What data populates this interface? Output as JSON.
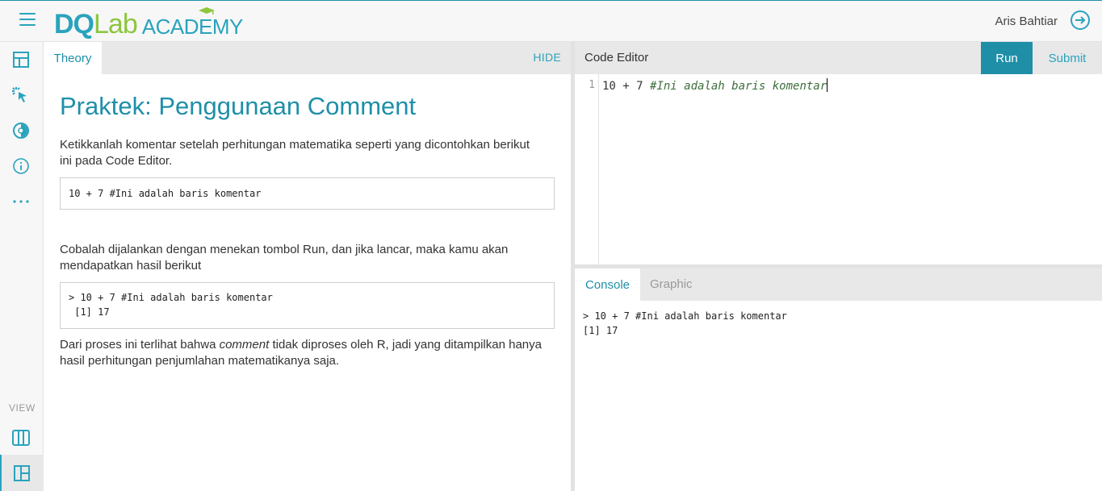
{
  "topbar": {
    "logo_dq": "DQ",
    "logo_lab": "Lab",
    "logo_academy": "ACADEMY",
    "user_name": "Aris Bahtiar"
  },
  "rail": {
    "view_label": "VIEW"
  },
  "theory": {
    "tab_label": "Theory",
    "hide_label": "HIDE",
    "title": "Praktek: Penggunaan Comment",
    "para1": "Ketikkanlah komentar setelah perhitungan matematika seperti yang dicontohkan berikut ini pada Code Editor.",
    "code1": "10 + 7 #Ini adalah baris komentar",
    "para2": "Cobalah dijalankan dengan menekan tombol Run, dan jika lancar, maka kamu akan mendapatkan hasil berikut",
    "code2_line1": "> 10 + 7 #Ini adalah baris komentar",
    "code2_line2": " [1] 17",
    "para3_before": "Dari proses ini terlihat bahwa ",
    "para3_em": "comment",
    "para3_after": " tidak diproses oleh R, jadi yang ditampilkan hanya hasil perhitungan penjumlahan matematikanya saja."
  },
  "editor": {
    "title": "Code Editor",
    "run_label": "Run",
    "submit_label": "Submit",
    "line_number": "1",
    "code_expr": "10 + 7 ",
    "code_comment": "#Ini adalah baris komentar"
  },
  "console": {
    "console_tab": "Console",
    "graphic_tab": "Graphic",
    "line1": "> 10 + 7 #Ini adalah baris komentar",
    "line2": "[1] 17"
  },
  "colors": {
    "accent": "#1f8fa8",
    "brand_green": "#8dc63f"
  },
  "icons": {
    "menu": "hamburger-menu-icon",
    "logout": "logout-icon",
    "layout": "layout-icon",
    "cursor_click": "cursor-click-icon",
    "theme": "theme-toggle-icon",
    "info": "info-icon",
    "more": "more-icon",
    "columns": "columns-view-icon",
    "split": "split-view-icon"
  }
}
